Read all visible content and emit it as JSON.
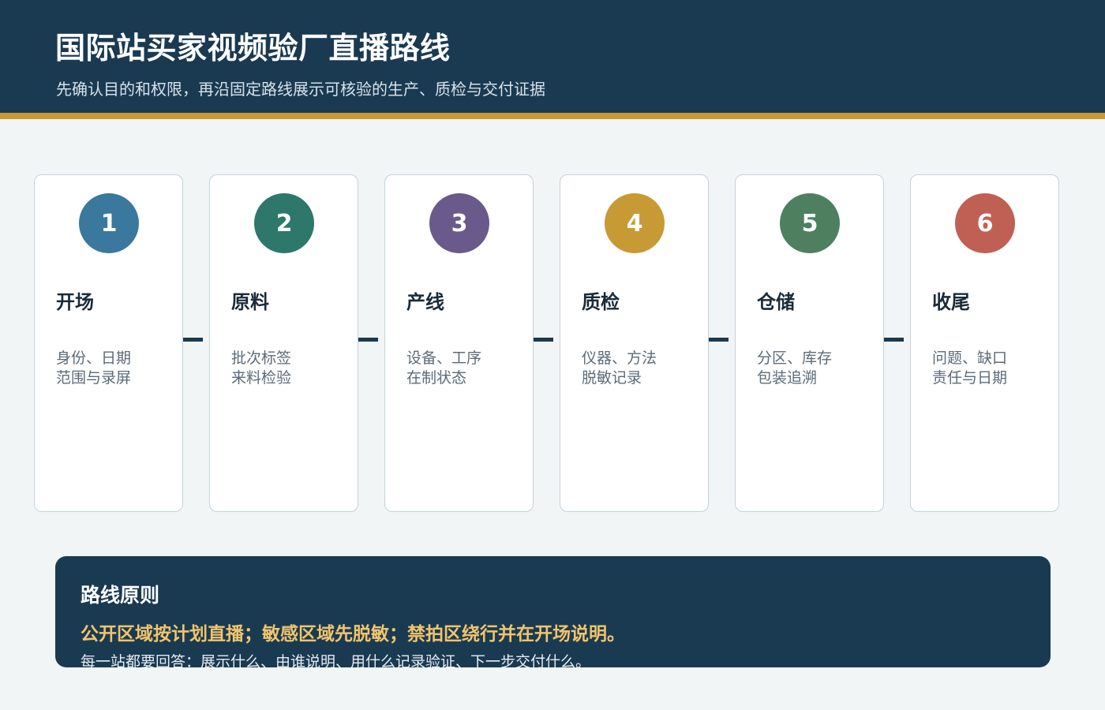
{
  "header": {
    "title": "国际站买家视频验厂直播路线",
    "subtitle": "先确认目的和权限，再沿固定路线展示可核验的生产、质检与交付证据"
  },
  "steps": [
    {
      "number": "1",
      "title": "开场",
      "line1": "身份、日期",
      "line2": "范围与录屏",
      "color": "#3b789e"
    },
    {
      "number": "2",
      "title": "原料",
      "line1": "批次标签",
      "line2": "来料检验",
      "color": "#2e776b"
    },
    {
      "number": "3",
      "title": "产线",
      "line1": "设备、工序",
      "line2": "在制状态",
      "color": "#6a5a8b"
    },
    {
      "number": "4",
      "title": "质检",
      "line1": "仪器、方法",
      "line2": "脱敏记录",
      "color": "#c89a35"
    },
    {
      "number": "5",
      "title": "仓储",
      "line1": "分区、库存",
      "line2": "包装追溯",
      "color": "#4e8060"
    },
    {
      "number": "6",
      "title": "收尾",
      "line1": "问题、缺口",
      "line2": "责任与日期",
      "color": "#c06054"
    }
  ],
  "principles": {
    "title": "路线原则",
    "highlight": "公开区域按计划直播；敏感区域先脱敏；禁拍区绕行并在开场说明。",
    "note": "每一站都要回答：展示什么、由谁说明、用什么记录验证、下一步交付什么。"
  }
}
